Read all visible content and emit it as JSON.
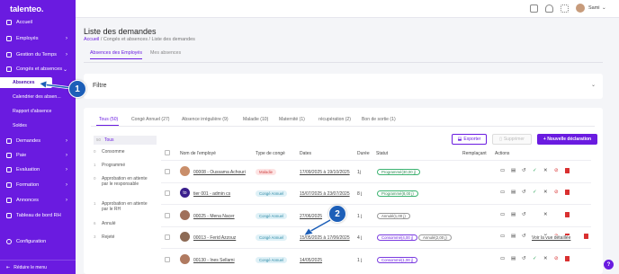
{
  "sidebar": {
    "logo": "talenteo.",
    "items": [
      {
        "label": "Accueil",
        "icon": "home-icon",
        "chevron": false
      },
      {
        "label": "Employés",
        "icon": "users-icon",
        "chevron": true
      },
      {
        "label": "Gestion du Temps",
        "icon": "clock-icon",
        "chevron": true
      },
      {
        "label": "Congés et absences",
        "icon": "calendar-icon",
        "chevron": true
      }
    ],
    "subitems": [
      {
        "label": "Absences",
        "active": true
      },
      {
        "label": "Calendrier des absen...",
        "active": false
      },
      {
        "label": "Rapport d'absence",
        "active": false
      },
      {
        "label": "Soldes",
        "active": false
      }
    ],
    "items2": [
      {
        "label": "Demandes",
        "icon": "inbox-icon"
      },
      {
        "label": "Paie",
        "icon": "money-icon"
      },
      {
        "label": "Evaluation",
        "icon": "star-icon"
      },
      {
        "label": "Formation",
        "icon": "graduation-icon"
      },
      {
        "label": "Annonces",
        "icon": "megaphone-icon"
      },
      {
        "label": "Tableau de bord RH",
        "icon": "dashboard-icon"
      }
    ],
    "configuration": "Configuration",
    "collapse": "Réduire le menu"
  },
  "topbar": {
    "username": "Sami"
  },
  "header": {
    "title": "Liste des demandes",
    "breadcrumb": {
      "root": "Accueil",
      "rest": "/ Congés et absences / Liste des demandes"
    },
    "tabs": [
      "Absences des Employés",
      "Mes absences"
    ]
  },
  "filter": {
    "label": "Filtre"
  },
  "status_tabs": [
    "Tous (50)",
    "Congé Annuel (27)",
    "Absence irrégulière (9)",
    "Maladie (10)",
    "Maternité (1)",
    "récupération (2)",
    "Bon de sortie (1)"
  ],
  "buttons": {
    "export": "Exporter",
    "delete": "Supprimer",
    "new": "+ Nouvelle déclaration"
  },
  "status_filters": [
    {
      "count": "50",
      "label": "Tous"
    },
    {
      "count": "0",
      "label": "Consomme"
    },
    {
      "count": "1",
      "label": "Programmé"
    },
    {
      "count": "0",
      "label": "Approbation en attente par le responsable"
    },
    {
      "count": "1",
      "label": "Approbation en attente par le RH"
    },
    {
      "count": "6",
      "label": "Annulé"
    },
    {
      "count": "3",
      "label": "Rejeté"
    }
  ],
  "table": {
    "headers": [
      "Nom de l'employé",
      "Type de congé",
      "Dates",
      "Durée",
      "Statut",
      "Remplaçant",
      "Actions"
    ],
    "rows": [
      {
        "name": "00008 - Oussama Achouri",
        "type": "Maladie",
        "dates": "17/09/2025 à 19/10/2025",
        "duration": "1j",
        "status": "Programmé(30,00 j)",
        "extra": ""
      },
      {
        "name": "tier 001 - admin cs",
        "type": "Congé Annuel",
        "dates": "15/07/2025 à 23/07/2025",
        "duration": "8 j",
        "status": "Programmé(8,00 j)",
        "extra": ""
      },
      {
        "name": "00025 - Mena Nacer",
        "type": "Congé Annuel",
        "dates": "27/06/2025",
        "duration": "1 j",
        "status": "Annulé(1,00 j)",
        "extra": ""
      },
      {
        "name": "00013 - Ferid Azzouz",
        "type": "Congé Annuel",
        "dates": "15/05/2025 à 17/06/2025",
        "duration": "4 j",
        "status": "Consommé(4,00 j)",
        "status2": "Annulé(2,00 j)",
        "extra": "Voir la vue détaillée"
      },
      {
        "name": "00130 - Ines Sellami",
        "type": "Congé Annuel",
        "dates": "14/05/2025",
        "duration": "1 j",
        "status": "Consommé(1,00 j)",
        "extra": ""
      }
    ]
  },
  "markers": [
    "1",
    "2"
  ],
  "help": "?"
}
